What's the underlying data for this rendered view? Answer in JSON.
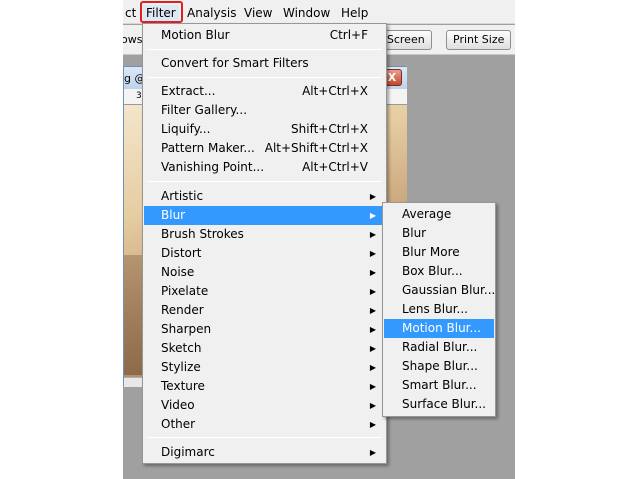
{
  "menubar": {
    "items": [
      {
        "label": "ct"
      },
      {
        "label": "Filter"
      },
      {
        "label": "Analysis"
      },
      {
        "label": "View"
      },
      {
        "label": "Window"
      },
      {
        "label": "Help"
      }
    ]
  },
  "optionsbar": {
    "left_text": "ows",
    "fit_screen": "it Screen",
    "print_size": "Print Size"
  },
  "document": {
    "title_fragment": "g @",
    "ruler_label": "3",
    "close_label": "X"
  },
  "filter_menu": {
    "last_filter": {
      "label": "Motion Blur",
      "shortcut": "Ctrl+F"
    },
    "convert": {
      "label": "Convert for Smart Filters"
    },
    "group_one": [
      {
        "label": "Extract...",
        "shortcut": "Alt+Ctrl+X"
      },
      {
        "label": "Filter Gallery...",
        "shortcut": ""
      },
      {
        "label": "Liquify...",
        "shortcut": "Shift+Ctrl+X"
      },
      {
        "label": "Pattern Maker...",
        "shortcut": "Alt+Shift+Ctrl+X"
      },
      {
        "label": "Vanishing Point...",
        "shortcut": "Alt+Ctrl+V"
      }
    ],
    "submenus": [
      {
        "label": "Artistic"
      },
      {
        "label": "Blur"
      },
      {
        "label": "Brush Strokes"
      },
      {
        "label": "Distort"
      },
      {
        "label": "Noise"
      },
      {
        "label": "Pixelate"
      },
      {
        "label": "Render"
      },
      {
        "label": "Sharpen"
      },
      {
        "label": "Sketch"
      },
      {
        "label": "Stylize"
      },
      {
        "label": "Texture"
      },
      {
        "label": "Video"
      },
      {
        "label": "Other"
      }
    ],
    "digimarc": {
      "label": "Digimarc"
    },
    "arrow_glyph": "▶"
  },
  "blur_submenu": {
    "items": [
      {
        "label": "Average"
      },
      {
        "label": "Blur"
      },
      {
        "label": "Blur More"
      },
      {
        "label": "Box Blur..."
      },
      {
        "label": "Gaussian Blur..."
      },
      {
        "label": "Lens Blur..."
      },
      {
        "label": "Motion Blur..."
      },
      {
        "label": "Radial Blur..."
      },
      {
        "label": "Shape Blur..."
      },
      {
        "label": "Smart Blur..."
      },
      {
        "label": "Surface Blur..."
      }
    ]
  },
  "colors": {
    "highlight": "#3399ff",
    "callout": "#e02020"
  }
}
